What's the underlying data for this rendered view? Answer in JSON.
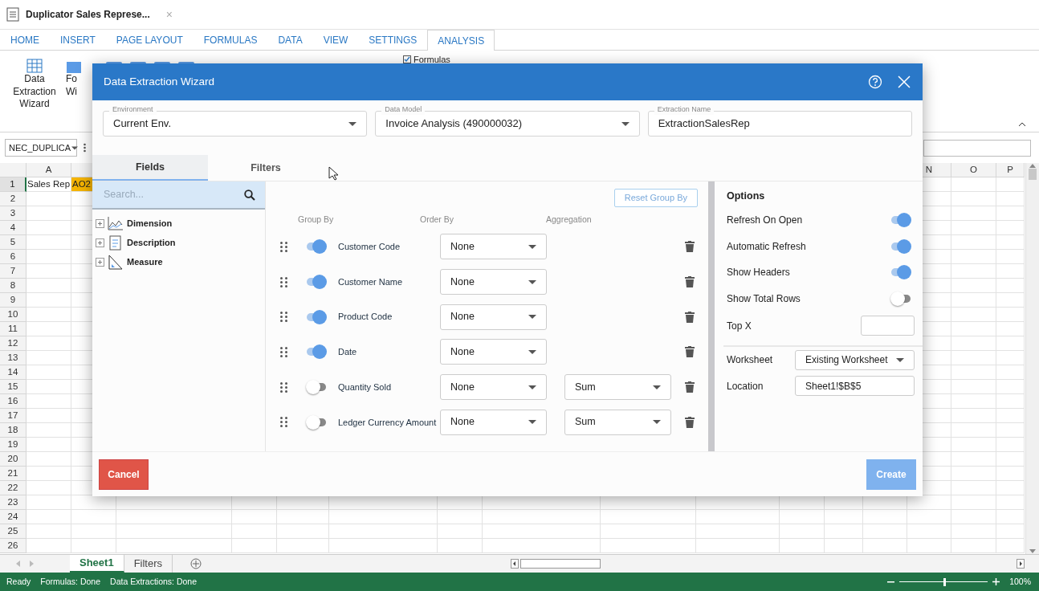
{
  "document_tab": {
    "title": "Duplicator Sales Represe...",
    "close": "×"
  },
  "ribbon_tabs": [
    {
      "label": "HOME",
      "selected": false
    },
    {
      "label": "INSERT",
      "selected": false
    },
    {
      "label": "PAGE LAYOUT",
      "selected": false
    },
    {
      "label": "FORMULAS",
      "selected": false
    },
    {
      "label": "DATA",
      "selected": false
    },
    {
      "label": "VIEW",
      "selected": false
    },
    {
      "label": "SETTINGS",
      "selected": false
    },
    {
      "label": "ANALYSIS",
      "selected": true
    }
  ],
  "ribbon": {
    "buttons": [
      {
        "lines": [
          "Data",
          "Extraction",
          "Wizard"
        ]
      },
      {
        "lines": [
          "Fo",
          "Wi"
        ]
      }
    ],
    "formulas_checkbox": {
      "label": "Formulas",
      "checked": true
    }
  },
  "name_box": {
    "value": "NEC_DUPLICA"
  },
  "sheet": {
    "columns": [
      {
        "label": "A"
      },
      {
        "label": "N"
      },
      {
        "label": "O"
      },
      {
        "label": "P"
      }
    ],
    "rows": [
      {
        "header": "1",
        "selected": true,
        "cells": [
          {
            "text": "Sales Rep",
            "selected": false
          },
          {
            "text": "AO2",
            "selected": true
          }
        ]
      },
      {
        "header": "2",
        "selected": false
      },
      {
        "header": "3",
        "selected": false
      },
      {
        "header": "4",
        "selected": false
      },
      {
        "header": "5",
        "selected": false
      },
      {
        "header": "6",
        "selected": false
      },
      {
        "header": "7",
        "selected": false
      },
      {
        "header": "8",
        "selected": false
      },
      {
        "header": "9",
        "selected": false
      },
      {
        "header": "10",
        "selected": false
      },
      {
        "header": "11",
        "selected": false
      },
      {
        "header": "12",
        "selected": false
      },
      {
        "header": "13",
        "selected": false
      },
      {
        "header": "14",
        "selected": false
      },
      {
        "header": "15",
        "selected": false
      },
      {
        "header": "16",
        "selected": false
      },
      {
        "header": "17",
        "selected": false
      },
      {
        "header": "18",
        "selected": false
      },
      {
        "header": "19",
        "selected": false
      },
      {
        "header": "20",
        "selected": false
      },
      {
        "header": "21",
        "selected": false
      },
      {
        "header": "22",
        "selected": false
      },
      {
        "header": "23",
        "selected": false
      },
      {
        "header": "24",
        "selected": false
      },
      {
        "header": "25",
        "selected": false
      },
      {
        "header": "26",
        "selected": false
      }
    ]
  },
  "sheet_tabs": [
    {
      "label": "Sheet1",
      "selected": true
    },
    {
      "label": "Filters",
      "selected": false
    }
  ],
  "status_bar": {
    "items": [
      "Ready",
      "Formulas: Done",
      "Data Extractions: Done"
    ],
    "zoom": {
      "label": "100%",
      "level": 0.5
    }
  },
  "dialog": {
    "title": "Data Extraction Wizard",
    "fields": [
      {
        "label": "Environment",
        "value": "Current Env.",
        "kind": "select"
      },
      {
        "label": "Data Model",
        "value": "Invoice Analysis (490000032)",
        "kind": "select"
      },
      {
        "label": "Extraction Name",
        "value": "ExtractionSalesRep",
        "kind": "text"
      }
    ],
    "tabs": [
      {
        "label": "Fields",
        "selected": true
      },
      {
        "label": "Filters",
        "selected": false
      }
    ],
    "search": {
      "placeholder": "Search..."
    },
    "tree": [
      {
        "label": "Dimension",
        "kind": "dimension",
        "expanded": false
      },
      {
        "label": "Description",
        "kind": "description",
        "expanded": false
      },
      {
        "label": "Measure",
        "kind": "measure",
        "expanded": false
      }
    ],
    "reset_button": "Reset Group By",
    "headings": [
      "Group By",
      "Order By",
      "Aggregation"
    ],
    "rows": [
      {
        "name": "Customer Code",
        "group_by": true,
        "order_by": "None"
      },
      {
        "name": "Customer Name",
        "group_by": true,
        "order_by": "None"
      },
      {
        "name": "Product Code",
        "group_by": true,
        "order_by": "None"
      },
      {
        "name": "Date",
        "group_by": true,
        "order_by": "None"
      },
      {
        "name": "Quantity Sold",
        "group_by": false,
        "order_by": "None",
        "aggregation": "Sum"
      },
      {
        "name": "Ledger Currency Amount",
        "group_by": false,
        "order_by": "None",
        "aggregation": "Sum"
      }
    ],
    "options": {
      "title": "Options",
      "toggles": [
        {
          "label": "Refresh On Open",
          "on": true
        },
        {
          "label": "Automatic Refresh",
          "on": true
        },
        {
          "label": "Show Headers",
          "on": true
        },
        {
          "label": "Show Total Rows",
          "on": false
        }
      ],
      "top_x": {
        "label": "Top X"
      },
      "worksheet": {
        "label": "Worksheet",
        "value": "Existing Worksheet"
      },
      "location": {
        "label": "Location",
        "value": "Sheet1!$B$5"
      }
    },
    "cancel": {
      "label": "Cancel"
    },
    "create": {
      "label": "Create",
      "disabled": true
    }
  }
}
